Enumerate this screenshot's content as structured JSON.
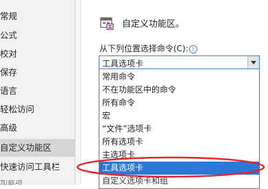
{
  "sidebar": {
    "items": [
      {
        "label": "常规"
      },
      {
        "label": "公式"
      },
      {
        "label": "校对"
      },
      {
        "label": "保存"
      },
      {
        "label": "语言"
      },
      {
        "label": "轻松访问"
      },
      {
        "label": "高级"
      },
      {
        "label": "自定义功能区",
        "selected": true
      },
      {
        "label": "快速访问工具栏"
      }
    ],
    "partial_item": "加载项"
  },
  "main": {
    "title": "自定义功能区。",
    "choose_label": "从下列位置选择命令(C):",
    "icons": {
      "header": "ribbon-customize-icon",
      "info": "info-icon",
      "dropdown": "chevron-down-icon"
    },
    "info_glyph": "i",
    "select": {
      "value": "工具选项卡",
      "options": [
        "常用命令",
        "不在功能区中的命令",
        "所有命令",
        "宏",
        "“文件”选项卡",
        "所有选项卡",
        "主选项卡",
        "工具选项卡",
        "自定义选项卡和组"
      ],
      "highlighted_index": 7
    }
  },
  "colors": {
    "highlight": "#2b78d8",
    "annotation": "#e0282e",
    "sidebar_selected": "#d6d6d6"
  }
}
